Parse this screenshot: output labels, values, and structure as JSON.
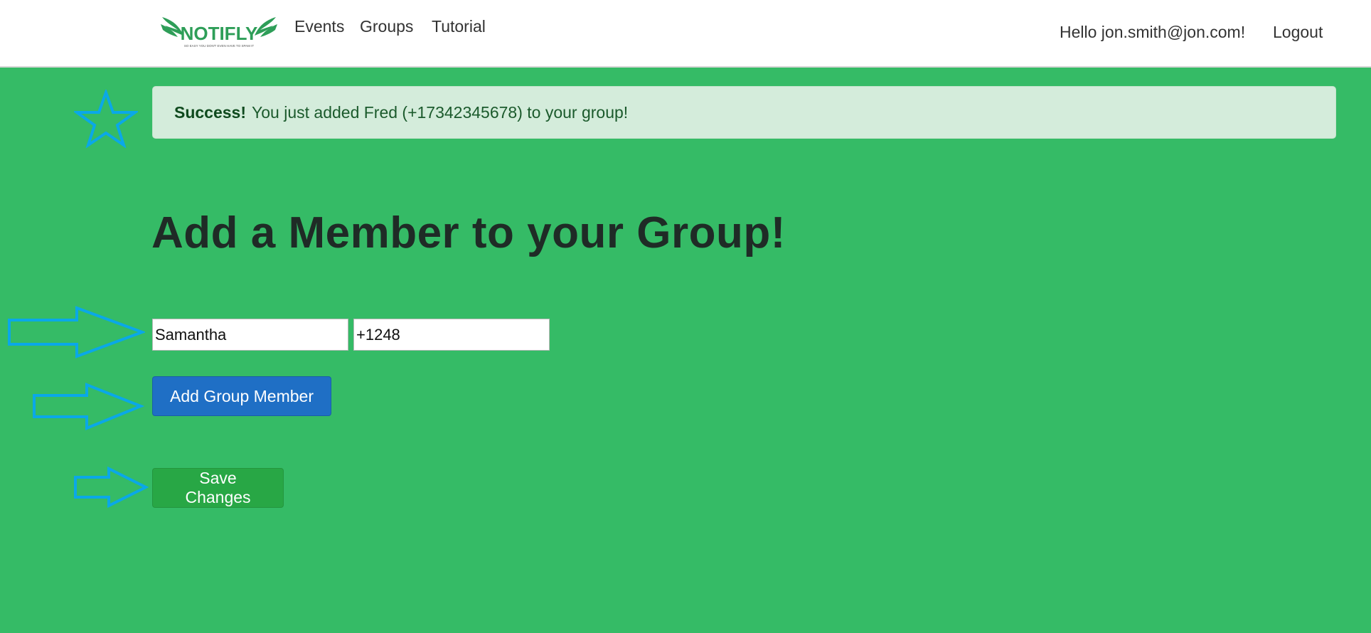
{
  "navbar": {
    "brand_name": "NOTIFLY",
    "brand_tagline": "SO EASY YOU DON'T EVEN HAVE TO SPAM IT",
    "links": [
      "Events",
      "Groups",
      "Tutorial"
    ],
    "greeting": "Hello jon.smith@jon.com!",
    "logout_label": "Logout"
  },
  "alert": {
    "strong": "Success!",
    "message": "You just added Fred (+17342345678) to your group!"
  },
  "page": {
    "title": "Add a Member to your Group!"
  },
  "form": {
    "name_value": "Samantha",
    "phone_value": "+1248",
    "add_button_label": "Add Group Member",
    "save_button_label": "Save Changes"
  },
  "colors": {
    "page_background": "#35bb66",
    "alert_background": "#d4ecdb",
    "primary_button": "#1f6fc5",
    "success_button": "#28a745",
    "annotation_stroke": "#0aa8e8"
  },
  "annotations": {
    "markers": [
      "star-icon",
      "arrow-right-icon",
      "arrow-right-icon",
      "arrow-right-icon"
    ]
  }
}
